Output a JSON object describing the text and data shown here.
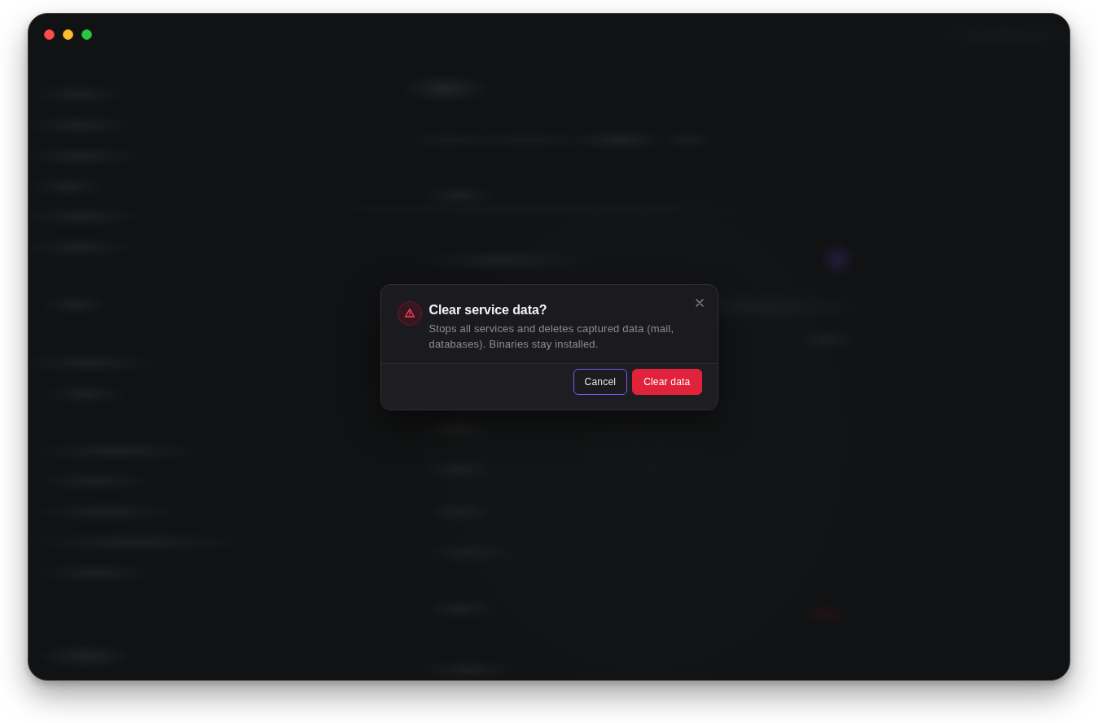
{
  "dialog": {
    "title": "Clear service data?",
    "message": "Stops all services and deletes captured data (mail, databases). Binaries stay installed.",
    "buttons": [
      {
        "label": "Cancel",
        "kind": "secondary",
        "focused": true
      },
      {
        "label": "Clear data",
        "kind": "danger",
        "focused": false
      }
    ]
  }
}
